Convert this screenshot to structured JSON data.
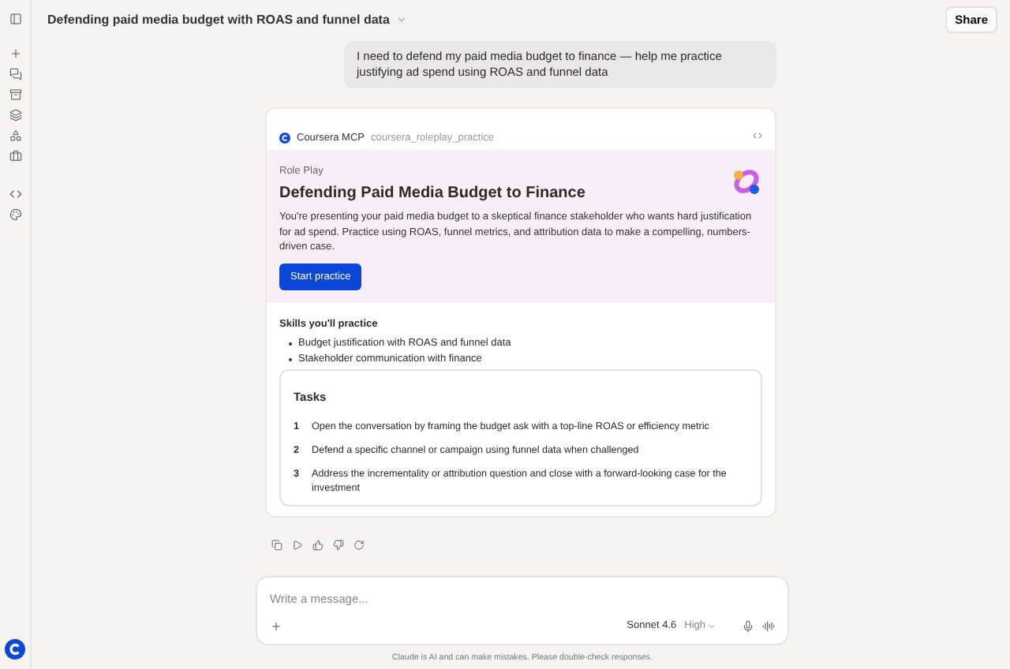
{
  "header": {
    "title": "Defending paid media budget with ROAS and funnel data",
    "share": "Share"
  },
  "user_message": "I need to defend my  paid media budget to finance — help me practice justifying ad spend using ROAS and funnel data",
  "tool": {
    "name": "Coursera MCP",
    "call": "coursera_roleplay_practice"
  },
  "roleplay": {
    "eyebrow": "Role Play",
    "title": "Defending Paid Media Budget to Finance",
    "description": "You're presenting your paid media budget to a skeptical finance stakeholder who wants hard justification for ad spend. Practice using ROAS, funnel metrics, and attribution data to make a compelling, numbers-driven case.",
    "button": "Start practice"
  },
  "skills": {
    "heading": "Skills you'll practice",
    "items": [
      "Budget justification with ROAS and funnel data",
      "Stakeholder communication with finance"
    ]
  },
  "tasks": {
    "heading": "Tasks",
    "items": [
      {
        "number": "1",
        "text": "Open the conversation by framing the budget ask with a top-line ROAS or efficiency metric"
      },
      {
        "number": "2",
        "text": "Defend a specific channel or campaign using funnel data when challenged"
      },
      {
        "number": "3",
        "text": "Address the incrementality or attribution question and close with a forward-looking case for the investment"
      }
    ]
  },
  "composer": {
    "placeholder": "Write a message...",
    "model": "Sonnet 4.6",
    "effort": "High"
  },
  "disclaimer": "Claude is AI and can make mistakes. Please double-check responses."
}
